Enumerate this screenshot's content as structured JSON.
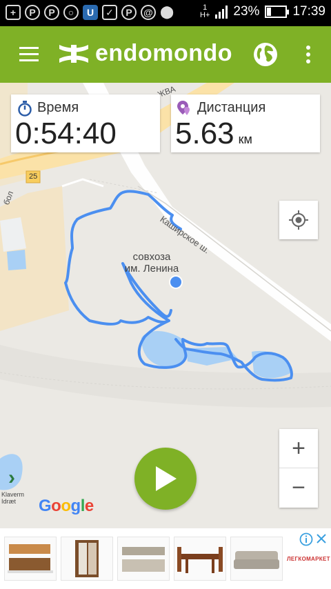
{
  "status_bar": {
    "battery_percent": "23%",
    "time": "17:39",
    "network": "H+",
    "sim": "1",
    "battery_level": 0.23,
    "notification_icons": [
      "plus-icon",
      "pinterest-icon",
      "pinterest-icon",
      "search-icon",
      "app-icon",
      "clipboard-icon",
      "pinterest-icon",
      "at-icon",
      "location-icon"
    ]
  },
  "app_bar": {
    "brand": "endomondo",
    "icons": [
      "menu-icon",
      "under-armour-logo",
      "globe-icon",
      "more-vert-icon"
    ]
  },
  "stats": {
    "time": {
      "label": "Время",
      "value": "0:54:40"
    },
    "distance": {
      "label": "Дистанция",
      "value": "5.63",
      "unit": "км"
    }
  },
  "map": {
    "place_label_line1": "совхоза",
    "place_label_line2": "им. Ленина",
    "road_label": "Каширское ш.",
    "road_number": "25",
    "road_fragment_1": "бол",
    "road_fragment_2": "ЖВА",
    "corner_label_1": "Klaverm",
    "corner_label_2": "Idræt",
    "provider": "Google",
    "route_color": "#4b8ff0",
    "zoom_in": "+",
    "zoom_out": "−"
  },
  "ad": {
    "brand": "ЛЕГКОМАРКЕТ",
    "items": [
      "kitchen",
      "wardrobe",
      "kitchen-set",
      "dining-set",
      "sofa"
    ]
  },
  "colors": {
    "accent": "#7fb126",
    "route": "#4b8ff0",
    "water": "#a9d0f5"
  }
}
